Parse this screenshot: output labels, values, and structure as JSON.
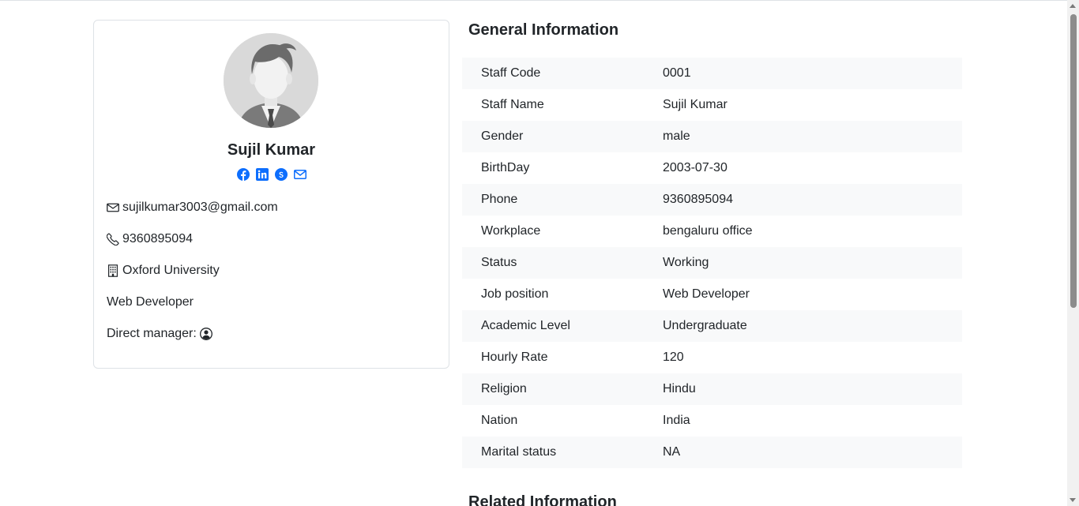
{
  "profile": {
    "name": "Sujil Kumar",
    "email": "sujilkumar3003@gmail.com",
    "phone": "9360895094",
    "organization": "Oxford University",
    "job_title": "Web Developer",
    "direct_manager_label": "Direct manager:",
    "social_icons": [
      "facebook-icon",
      "linkedin-icon",
      "skype-icon",
      "mail-icon"
    ]
  },
  "general": {
    "title": "General Information",
    "rows": [
      {
        "label": "Staff Code",
        "value": "0001"
      },
      {
        "label": "Staff Name",
        "value": "Sujil Kumar"
      },
      {
        "label": "Gender",
        "value": "male"
      },
      {
        "label": "BirthDay",
        "value": "2003-07-30"
      },
      {
        "label": "Phone",
        "value": "9360895094"
      },
      {
        "label": "Workplace",
        "value": "bengaluru office"
      },
      {
        "label": "Status",
        "value": "Working"
      },
      {
        "label": "Job position",
        "value": "Web Developer"
      },
      {
        "label": "Academic Level",
        "value": "Undergraduate"
      },
      {
        "label": "Hourly Rate",
        "value": "120"
      },
      {
        "label": "Religion",
        "value": "Hindu"
      },
      {
        "label": "Nation",
        "value": "India"
      },
      {
        "label": "Marital status",
        "value": "NA"
      }
    ]
  },
  "related": {
    "title": "Related Information"
  },
  "colors": {
    "accent": "#0d6efd",
    "stripe": "#f8f9fa",
    "border": "#dee2e6",
    "text": "#212529"
  }
}
